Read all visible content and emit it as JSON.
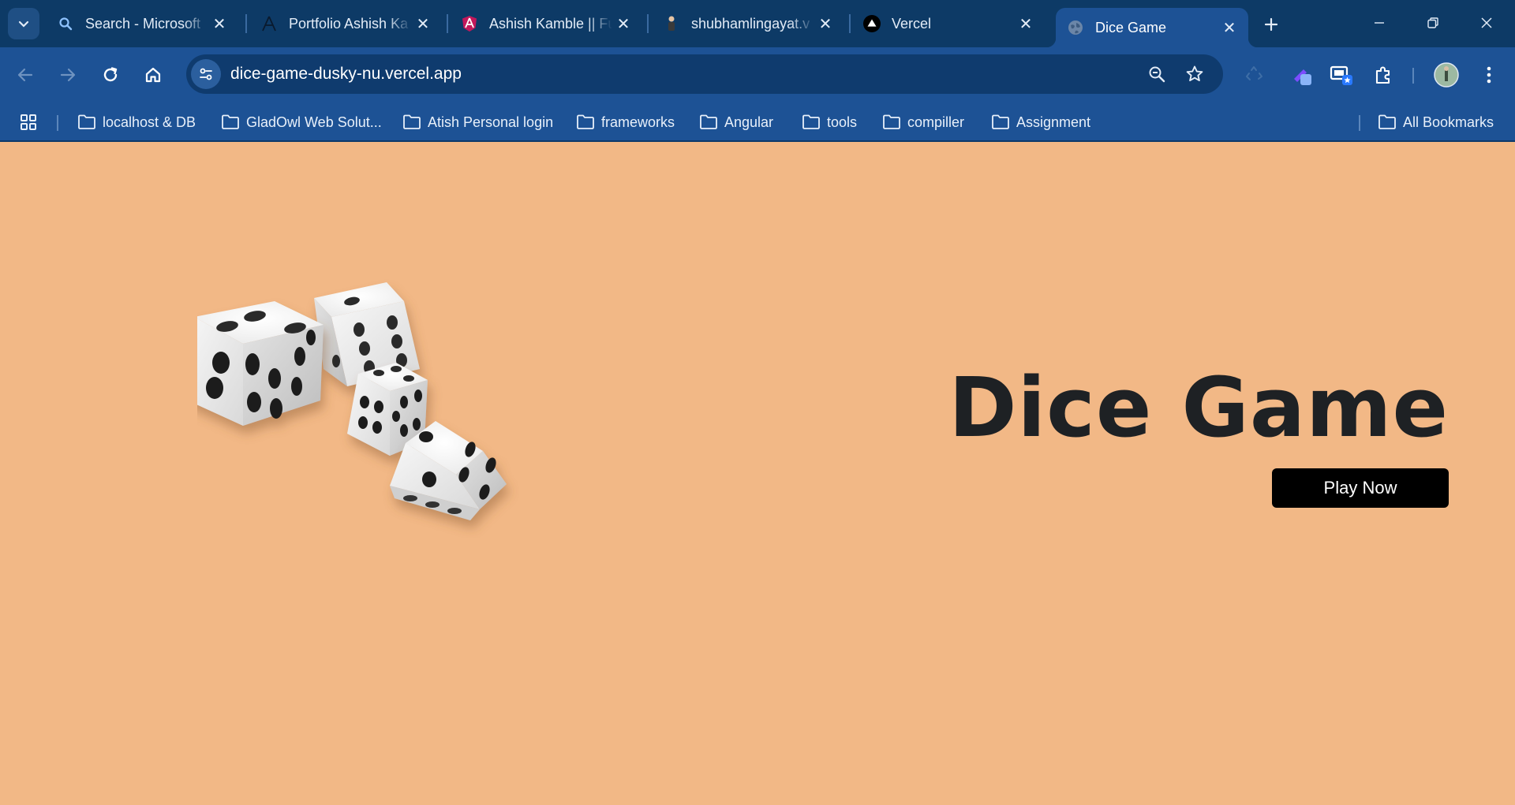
{
  "tabs": [
    {
      "title": "Search - Microsoft",
      "icon": "search-icon",
      "active": false
    },
    {
      "title": "Portfolio Ashish Ka",
      "icon": "angular-outline-icon",
      "active": false
    },
    {
      "title": "Ashish Kamble || Fu",
      "icon": "angular-color-icon",
      "active": false
    },
    {
      "title": "shubhamlingayat.v",
      "icon": "person-icon",
      "active": false
    },
    {
      "title": "Vercel",
      "icon": "vercel-icon",
      "active": false
    },
    {
      "title": "Dice Game",
      "icon": "globe-icon",
      "active": true
    }
  ],
  "toolbar": {
    "url": "dice-game-dusky-nu.vercel.app"
  },
  "bookmarks": [
    {
      "label": "localhost & DB"
    },
    {
      "label": "GladOwl Web Solut..."
    },
    {
      "label": "Atish Personal login"
    },
    {
      "label": "frameworks"
    },
    {
      "label": "Angular"
    },
    {
      "label": "tools"
    },
    {
      "label": "compiller"
    },
    {
      "label": "Assignment"
    }
  ],
  "all_bookmarks_label": "All Bookmarks",
  "page": {
    "title": "Dice Game",
    "play_button": "Play Now"
  },
  "colors": {
    "tabstrip": "#0d3a66",
    "toolbar": "#1d5295",
    "page_background": "#f2b886",
    "title_text": "#1e2124",
    "button": "#000000"
  }
}
